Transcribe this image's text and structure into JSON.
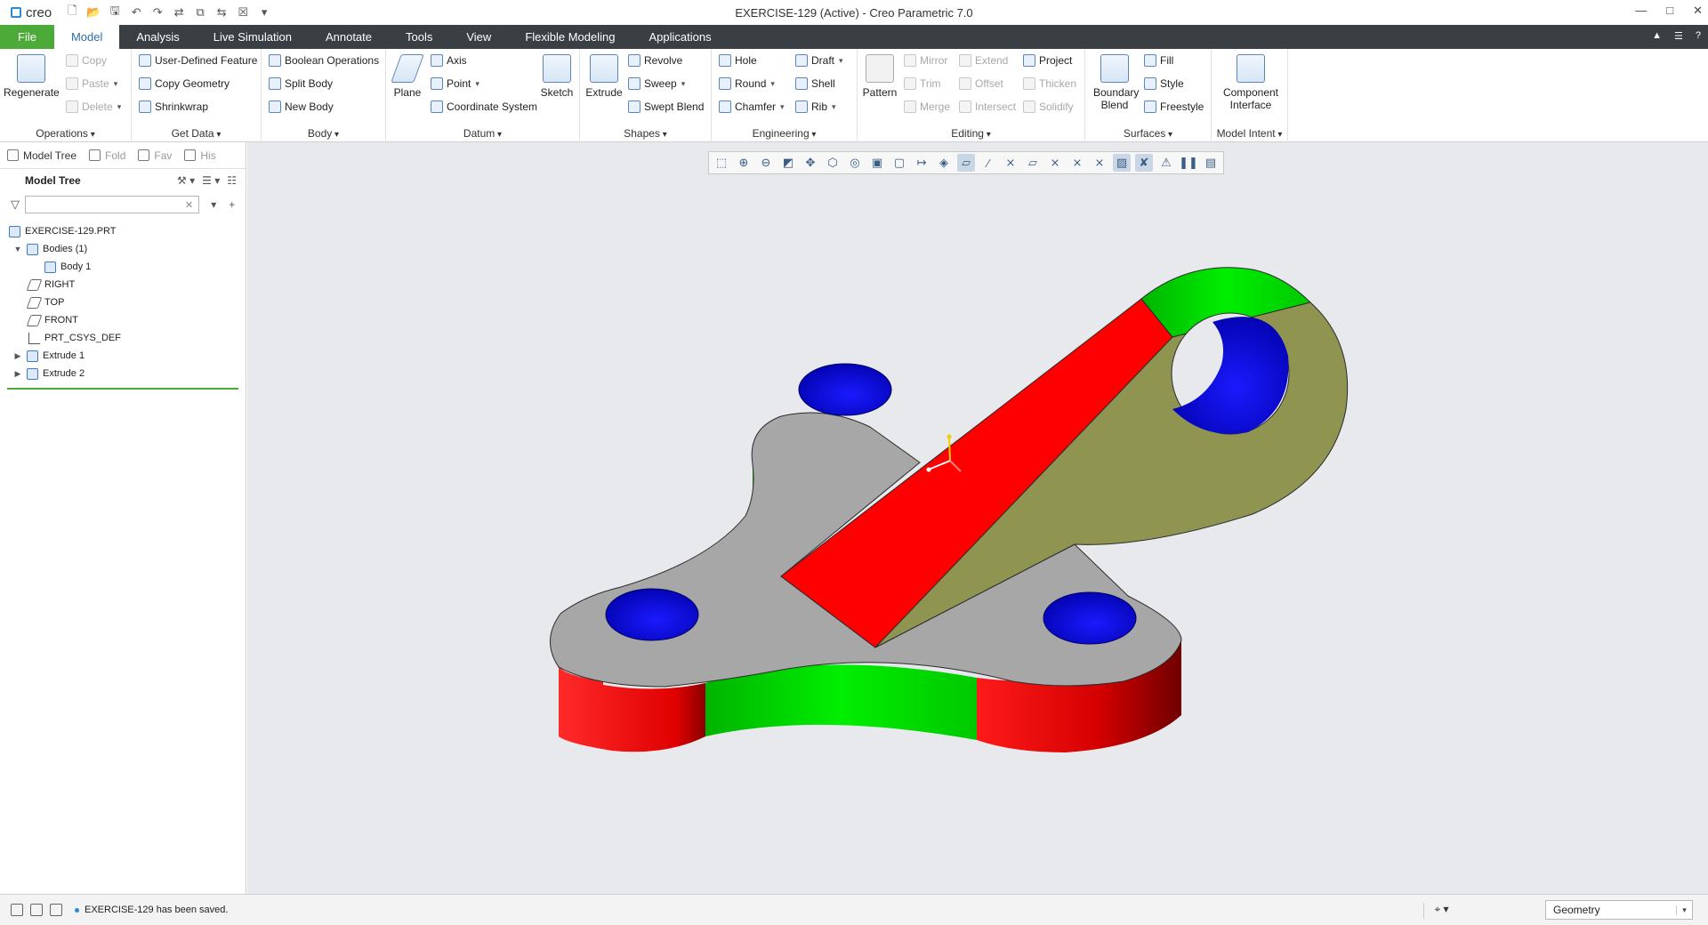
{
  "app": {
    "logo_text": "creo",
    "window_title": "EXERCISE-129 (Active) - Creo Parametric 7.0",
    "window_controls": [
      "—",
      "□",
      "✕"
    ]
  },
  "quick_access": [
    "new-icon",
    "open-icon",
    "save-icon",
    "undo-icon",
    "redo-icon",
    "regenerate-icon",
    "windows-icon",
    "switch-icon",
    "close-icon",
    "customize-icon"
  ],
  "tabs": [
    {
      "label": "File"
    },
    {
      "label": "Model"
    },
    {
      "label": "Analysis"
    },
    {
      "label": "Live Simulation"
    },
    {
      "label": "Annotate"
    },
    {
      "label": "Tools"
    },
    {
      "label": "View"
    },
    {
      "label": "Flexible Modeling"
    },
    {
      "label": "Applications"
    }
  ],
  "ribbon": {
    "operations": {
      "label": "Operations",
      "regenerate": "Regenerate",
      "copy": "Copy",
      "paste": "Paste",
      "delete": "Delete"
    },
    "get_data": {
      "label": "Get Data",
      "udf": "User-Defined Feature",
      "copy_geometry": "Copy Geometry",
      "shrinkwrap": "Shrinkwrap"
    },
    "body": {
      "label": "Body",
      "boolean": "Boolean Operations",
      "split": "Split Body",
      "new": "New Body"
    },
    "datum": {
      "label": "Datum",
      "plane": "Plane",
      "axis": "Axis",
      "point": "Point",
      "csys": "Coordinate System",
      "sketch": "Sketch"
    },
    "shapes": {
      "label": "Shapes",
      "extrude": "Extrude",
      "revolve": "Revolve",
      "sweep": "Sweep",
      "swept_blend": "Swept Blend"
    },
    "engineering": {
      "label": "Engineering",
      "hole": "Hole",
      "round": "Round",
      "chamfer": "Chamfer",
      "draft": "Draft",
      "shell": "Shell",
      "rib": "Rib"
    },
    "editing": {
      "label": "Editing",
      "pattern": "Pattern",
      "mirror": "Mirror",
      "trim": "Trim",
      "merge": "Merge",
      "extend": "Extend",
      "offset": "Offset",
      "intersect": "Intersect",
      "project": "Project",
      "thicken": "Thicken",
      "solidify": "Solidify"
    },
    "surfaces": {
      "label": "Surfaces",
      "boundary_blend": "Boundary Blend",
      "fill": "Fill",
      "style": "Style",
      "freestyle": "Freestyle"
    },
    "model_intent": {
      "label": "Model Intent",
      "component_interface": "Component Interface"
    }
  },
  "navigator": {
    "tabs": [
      "Model Tree",
      "Fold",
      "Fav",
      "His"
    ],
    "title": "Model Tree",
    "filter_placeholder": "",
    "tree": [
      {
        "label": "EXERCISE-129.PRT",
        "indent": 0,
        "expander": "",
        "icon": "part-icon"
      },
      {
        "label": "Bodies (1)",
        "indent": 0,
        "expander": "▼",
        "icon": "bodies-icon"
      },
      {
        "label": "Body 1",
        "indent": 1,
        "expander": "",
        "icon": "body-icon"
      },
      {
        "label": "RIGHT",
        "indent": 0,
        "expander": "",
        "icon": "datum-plane-icon"
      },
      {
        "label": "TOP",
        "indent": 0,
        "expander": "",
        "icon": "datum-plane-icon"
      },
      {
        "label": "FRONT",
        "indent": 0,
        "expander": "",
        "icon": "datum-plane-icon"
      },
      {
        "label": "PRT_CSYS_DEF",
        "indent": 0,
        "expander": "",
        "icon": "csys-icon"
      },
      {
        "label": "Extrude 1",
        "indent": 0,
        "expander": "▶",
        "icon": "extrude-icon"
      },
      {
        "label": "Extrude 2",
        "indent": 0,
        "expander": "▶",
        "icon": "extrude-icon"
      }
    ]
  },
  "view_toolbar": [
    "refit-icon",
    "zoom-in-icon",
    "zoom-out-icon",
    "repaint-icon",
    "pan-zoom-icon",
    "saved-orientations-icon",
    "named-views-icon",
    "display-style-icon",
    "spin-center-icon",
    "annotation-display-icon",
    "plane-display-icon",
    "axis-display-icon",
    "point-display-icon",
    "csys-display-icon",
    "csys-tag-icon",
    "perspective-icon",
    "section-icon",
    "appearance-icon",
    "pause-icon",
    "stop-icon"
  ],
  "colors": {
    "file_tab": "#4cab38",
    "tab_bar": "#3a3f44",
    "graphics_bg": "#e7e9ed",
    "face_gray": "#a7a7a7",
    "face_red": "#ff0000",
    "face_green": "#00dd00",
    "face_blue": "#0000ee",
    "face_olive": "#8f9450"
  },
  "status": {
    "message": "EXERCISE-129 has been saved.",
    "selection_filter": "Geometry"
  }
}
